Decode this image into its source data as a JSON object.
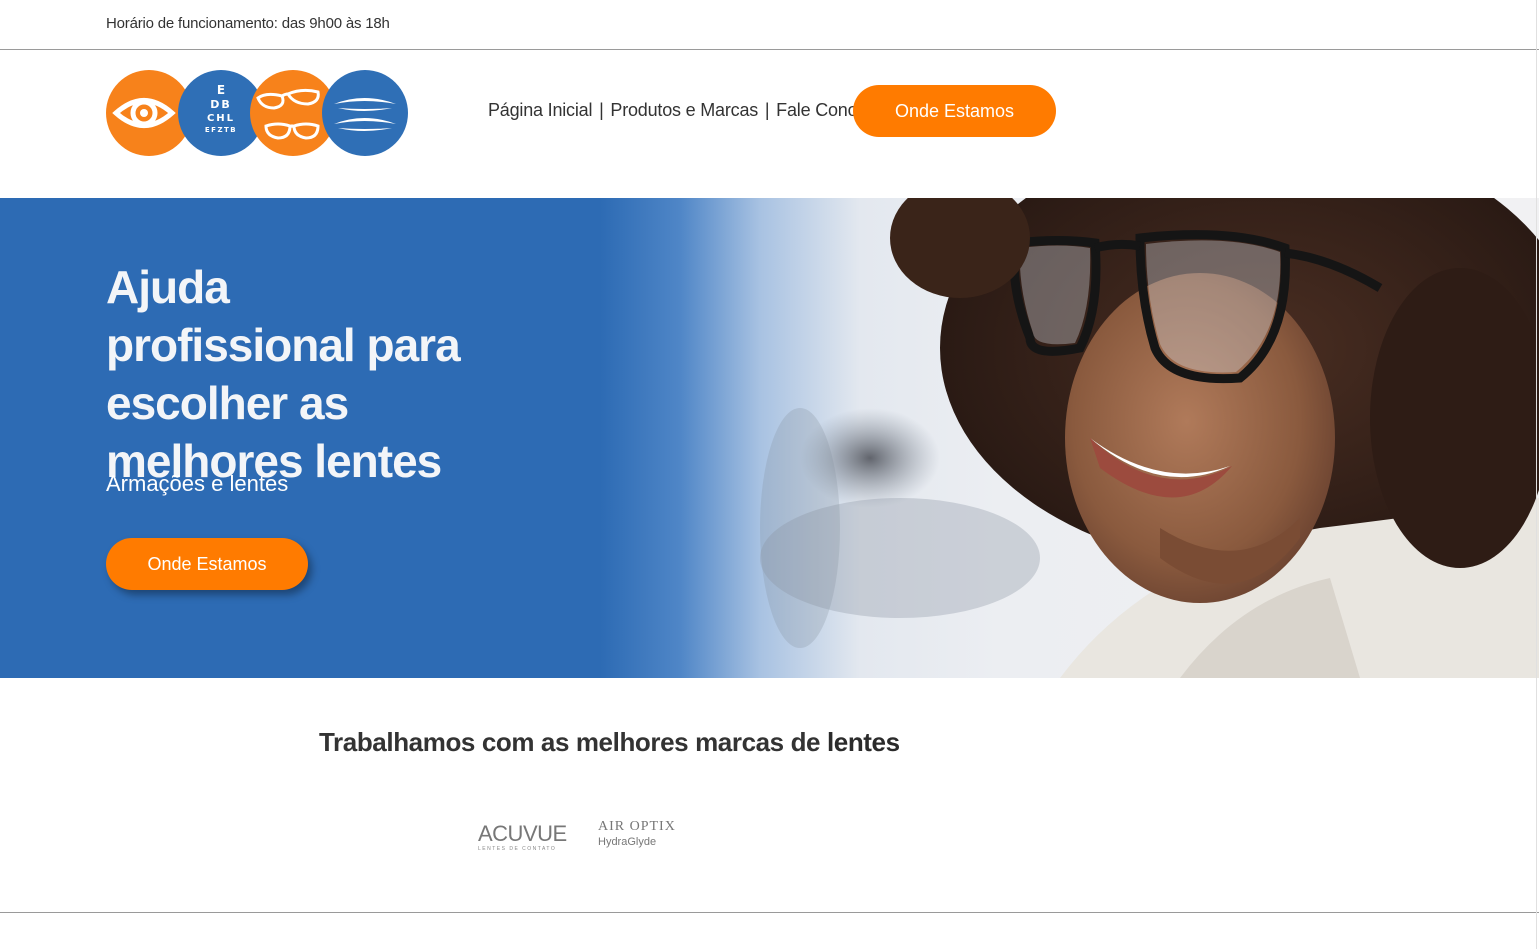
{
  "topbar": {
    "hours": "Horário de funcionamento: das 9h00 às 18h"
  },
  "header": {
    "nav": [
      "Página Inicial",
      "Produtos e Marcas",
      "Fale Conosco"
    ],
    "cta": "Onde Estamos"
  },
  "logo": {
    "chart_letters": [
      "E",
      "DB",
      "CHL",
      "EFZTB"
    ]
  },
  "hero": {
    "headline": "Ajuda profissional para escolher as melhores lentes",
    "subheadline": "Armações e lentes",
    "cta": "Onde Estamos"
  },
  "brands": {
    "title_prefix": "Trabalhamos com as melhores marcas de ",
    "title_bold": "lentes",
    "items": [
      {
        "name": "ACUVUE",
        "tagline": "LENTES DE CONTATO"
      },
      {
        "name": "AIR OPTIX",
        "tagline": "HydraGlyde"
      }
    ]
  },
  "colors": {
    "orange": "#ff7b00",
    "blue": "#2d6bb4",
    "text": "#333333"
  }
}
